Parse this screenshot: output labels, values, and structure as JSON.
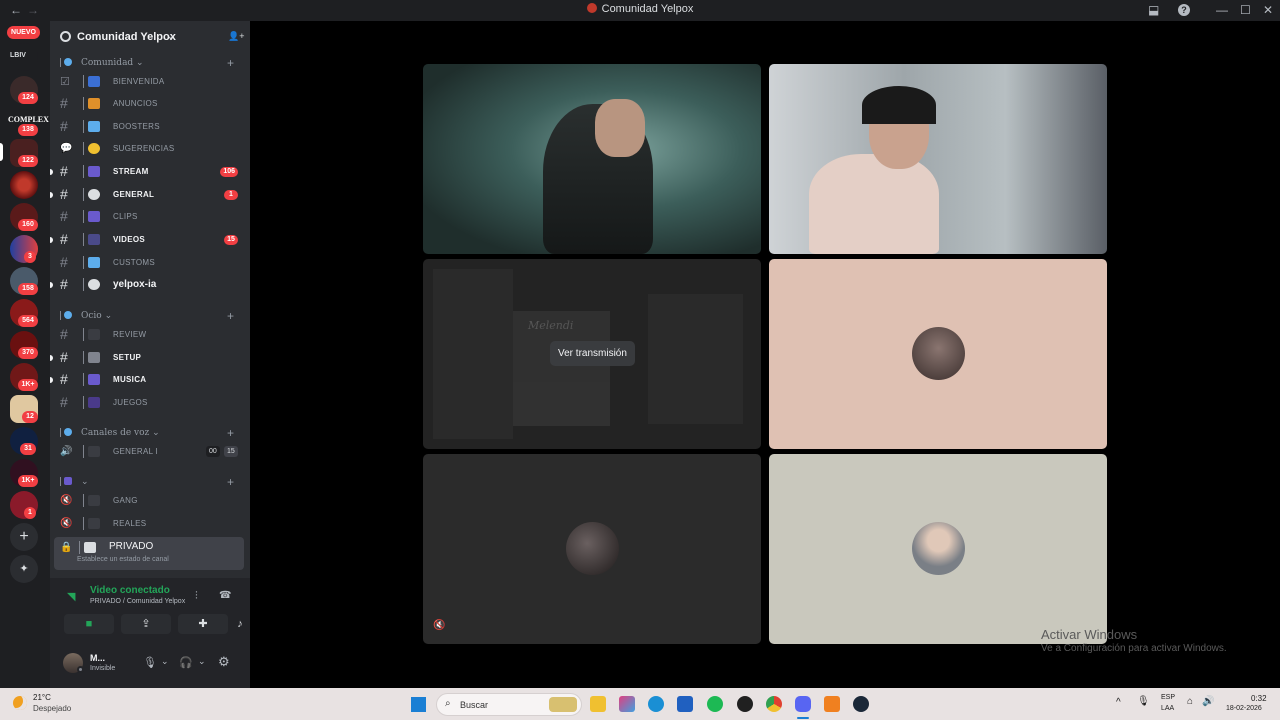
{
  "window": {
    "title": "Comunidad Yelpox",
    "back": "←",
    "forward": "→",
    "inbox_icon": "⬓",
    "help_icon": "?",
    "minimize": "—",
    "maximize": "☐",
    "close": "✕"
  },
  "rail": {
    "new_label": "NUEVO",
    "lbiv_label": "LBIV",
    "complex_label": "COMPLEX",
    "badges": [
      "124",
      "138",
      "122",
      "160",
      "3",
      "158",
      "564",
      "370",
      "1K+",
      "12",
      "31",
      "1K+",
      "1"
    ],
    "add_icon": "+",
    "explore_icon": "✦"
  },
  "guild": {
    "name": "Comunidad Yelpox",
    "chevron": "⌄",
    "add_member_icon": "👤+"
  },
  "categories": [
    {
      "label": "Comunidad ⌄",
      "plus": "+"
    },
    {
      "label": "Ocio ⌄",
      "plus": "+"
    },
    {
      "label": "Canales de voz ⌄",
      "plus": "+"
    },
    {
      "label": "⌄",
      "plus": "+"
    }
  ],
  "channels": [
    {
      "name": "BIENVENIDA",
      "icon": "☑",
      "count": ""
    },
    {
      "name": "ANUNCIOS",
      "icon": "#",
      "count": ""
    },
    {
      "name": "BOOSTERS",
      "icon": "#",
      "count": ""
    },
    {
      "name": "SUGERENCIAS",
      "icon": "💬",
      "count": ""
    },
    {
      "name": "STREAM",
      "icon": "#",
      "count": "106"
    },
    {
      "name": "GENERAL",
      "icon": "#",
      "count": "1"
    },
    {
      "name": "CLIPS",
      "icon": "#",
      "count": ""
    },
    {
      "name": "VIDEOS",
      "icon": "#",
      "count": "15"
    },
    {
      "name": "CUSTOMS",
      "icon": "#",
      "count": ""
    },
    {
      "name": "yelpox-ia",
      "icon": "#",
      "count": ""
    },
    {
      "name": "REVIEW",
      "icon": "#",
      "count": ""
    },
    {
      "name": "SETUP",
      "icon": "#",
      "count": ""
    },
    {
      "name": "MUSICA",
      "icon": "#",
      "count": ""
    },
    {
      "name": "JUEGOS",
      "icon": "#",
      "count": ""
    }
  ],
  "voice_channels": [
    {
      "name": "GENERAL I",
      "icon": "🔊",
      "left_count": "00",
      "right_count": "15"
    },
    {
      "name": "GANG",
      "icon": "🔇"
    },
    {
      "name": "REALES",
      "icon": "🔇"
    },
    {
      "name": "PRIVADO",
      "icon": "🔒",
      "status": "Establece un estado de canal"
    }
  ],
  "voice_panel": {
    "status": "Video conectado",
    "channel": "PRIVADO / Comunidad Yelpox",
    "soundboard_icon": "⫶",
    "disconnect_icon": "☎",
    "camera_icon": "■",
    "screen_icon": "⇪",
    "activity_icon": "✚",
    "soundboard2_icon": "♪"
  },
  "user": {
    "name": "M...",
    "status": "Invisible",
    "mic_icon": "🎙",
    "headset_icon": "🎧",
    "settings_icon": "⚙",
    "chevron": "⌄"
  },
  "stage": {
    "watch_label": "Ver transmisión",
    "muted_icon": "🔇",
    "album_text": "Melendi"
  },
  "watermark": {
    "line1": "Activar Windows",
    "line2": "Ve a Configuración para activar Windows."
  },
  "taskbar": {
    "temperature": "21°C",
    "weather": "Despejado",
    "search_placeholder": "Buscar",
    "lang_1": "ESP",
    "lang_2": "LAA",
    "time": "0:32",
    "date": "18-02-2026",
    "tray_chevron": "^",
    "mic_icon": "🎙",
    "wifi_icon": "⌂",
    "volume_icon": "🔊"
  }
}
